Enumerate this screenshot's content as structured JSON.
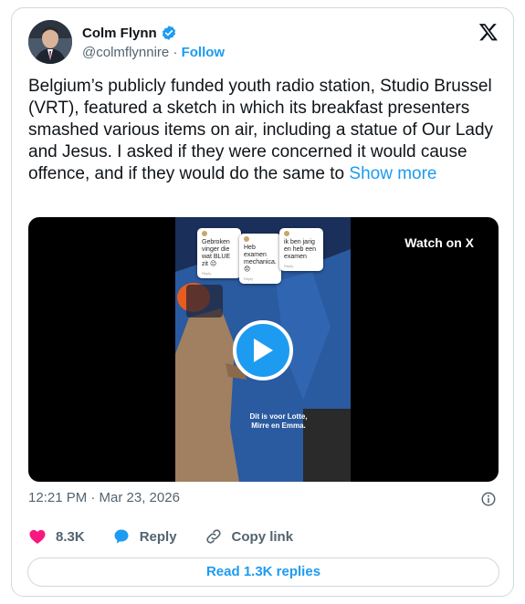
{
  "author": {
    "name": "Colm Flynn",
    "handle": "@colmflynnire",
    "separator": "·",
    "follow_label": "Follow"
  },
  "post": {
    "text": "Belgium’s publicly funded youth radio station, Studio Brussel (VRT), featured a sketch in which its breakfast presenters smashed various items on air, including a statue of Our Lady and Jesus. I asked if they were concerned it would cause offence, and if they would do the same to ",
    "show_more_label": "Show more"
  },
  "media": {
    "watch_label": "Watch on X",
    "overlay_cards": [
      {
        "text": "Gebroken vinger die wat BLUE zit 😔",
        "foot": "Reply"
      },
      {
        "text": "Heb examen mechanica. 😞",
        "foot": "Reply"
      },
      {
        "text": "ik ben jarig en heb een examen",
        "foot": "Reply"
      }
    ],
    "subtitle": "Dit is voor Lotte,\nMirre en Emma."
  },
  "timestamp": "12:21 PM · Mar 23, 2026",
  "actions": {
    "likes": "8.3K",
    "reply_label": "Reply",
    "copy_label": "Copy link"
  },
  "read_replies_label": "Read 1.3K replies",
  "colors": {
    "accent": "#1d9bf0",
    "like": "#f91880",
    "muted": "#536471",
    "border": "#cfd9de"
  }
}
